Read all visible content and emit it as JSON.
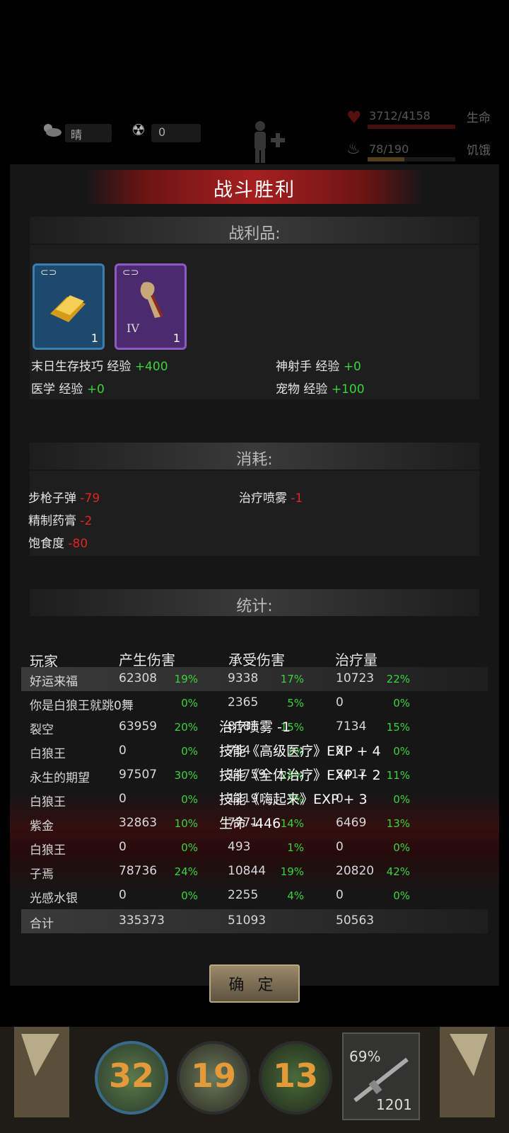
{
  "status_bar": {
    "weather": "晴",
    "radiation": "0",
    "life_value": "3712/4158",
    "life_fraction": 0.89,
    "life_label": "生命",
    "food_value": "78/190",
    "food_fraction": 0.41,
    "food_label": "饥饿"
  },
  "banner_title": "战斗胜利",
  "loot": {
    "title": "战利品:",
    "items": [
      {
        "icon": "gold-bar-icon",
        "qty": "1",
        "rarity": "blue"
      },
      {
        "icon": "claw-icon",
        "qty": "1",
        "tier": "IV",
        "rarity": "purple"
      }
    ],
    "exp": [
      {
        "label": "末日生存技巧 经验",
        "value": "+400"
      },
      {
        "label": "神射手 经验",
        "value": "+0"
      },
      {
        "label": "医学 经验",
        "value": "+0"
      },
      {
        "label": "宠物 经验",
        "value": "+100"
      }
    ]
  },
  "consumption": {
    "title": "消耗:",
    "items": [
      {
        "label": "步枪子弹",
        "value": "-79"
      },
      {
        "label": "治疗喷雾",
        "value": "-1"
      },
      {
        "label": "精制药膏",
        "value": "-2"
      },
      {
        "label": "饱食度",
        "value": "-80"
      }
    ]
  },
  "stats": {
    "title": "统计:",
    "headers": [
      "玩家",
      "产生伤害",
      "承受伤害",
      "治疗量"
    ],
    "rows": [
      {
        "name": "好运来福",
        "dmg": "62308",
        "dmg_pct": "19%",
        "taken": "9338",
        "taken_pct": "17%",
        "heal": "10723",
        "heal_pct": "22%"
      },
      {
        "name": "你是白狼王就跳0舞",
        "dmg": "",
        "dmg_pct": "0%",
        "taken": "2365",
        "taken_pct": "5%",
        "heal": "0",
        "heal_pct": "0%"
      },
      {
        "name": "裂空",
        "dmg": "63959",
        "dmg_pct": "20%",
        "taken": "8181",
        "taken_pct": "15%",
        "heal": "7134",
        "heal_pct": "15%"
      },
      {
        "name": "白狼王",
        "dmg": "0",
        "dmg_pct": "0%",
        "taken": "754",
        "taken_pct": "2%",
        "heal": "0",
        "heal_pct": "0%"
      },
      {
        "name": "永生的期望",
        "dmg": "97507",
        "dmg_pct": "30%",
        "taken": "14759",
        "taken_pct": "28%",
        "heal": "5417",
        "heal_pct": "11%"
      },
      {
        "name": "白狼王",
        "dmg": "0",
        "dmg_pct": "0%",
        "taken": "1219",
        "taken_pct": "3%",
        "heal": "0",
        "heal_pct": "0%"
      },
      {
        "name": "紫金",
        "dmg": "32863",
        "dmg_pct": "10%",
        "taken": "7771",
        "taken_pct": "14%",
        "heal": "6469",
        "heal_pct": "13%"
      },
      {
        "name": "白狼王",
        "dmg": "0",
        "dmg_pct": "0%",
        "taken": "493",
        "taken_pct": "1%",
        "heal": "0",
        "heal_pct": "0%"
      },
      {
        "name": "子焉",
        "dmg": "78736",
        "dmg_pct": "24%",
        "taken": "10844",
        "taken_pct": "19%",
        "heal": "20820",
        "heal_pct": "42%"
      },
      {
        "name": "光感水银",
        "dmg": "0",
        "dmg_pct": "0%",
        "taken": "2255",
        "taken_pct": "4%",
        "heal": "0",
        "heal_pct": "0%"
      }
    ],
    "total": {
      "label": "合计",
      "dmg": "335373",
      "taken": "51093",
      "heal": "50563"
    }
  },
  "floating_log": [
    "治疗喷雾 -1",
    "技能《高级医疗》EXP + 4",
    "技能《全体治疗》EXP + 2",
    "技能《嗨起来》EXP + 3",
    "生命 -446"
  ],
  "confirm_label": "确 定",
  "bottom": {
    "skills": [
      "32",
      "19",
      "13"
    ],
    "weapon_pct": "69%",
    "weapon_ammo": "1201"
  }
}
